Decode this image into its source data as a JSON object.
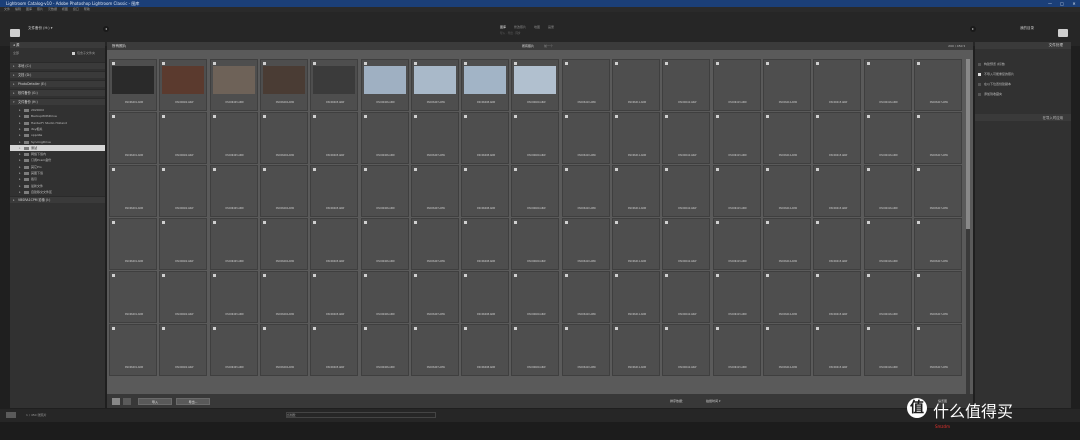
{
  "window": {
    "title": "Lightroom Catalog-v10 - Adobe Photoshop Lightroom Classic - 图库",
    "min": "—",
    "max": "□",
    "close": "✕"
  },
  "menu": [
    "文件",
    "编辑",
    "图库",
    "照片",
    "元数据",
    "视图",
    "窗口",
    "帮助"
  ],
  "top": {
    "source_label": "文件备份 (H:) ▾",
    "modules": [
      "图库",
      "修改照片",
      "地图",
      "画册",
      "幻灯片放映",
      "打印",
      "Web"
    ],
    "active_module": "图库",
    "submodule_line": "导入 · 导出 · 同步",
    "right_label": "我的目录"
  },
  "left": {
    "nav_header": "◂ 源",
    "nav_sub_left": "全部",
    "nav_sub_right": "包含子文件夹",
    "sections": [
      {
        "label": "本地 (C:)"
      },
      {
        "label": "文档 (D:)"
      },
      {
        "label": "PhotoDetailer (E:)"
      },
      {
        "label": "软件备份 (G:)"
      },
      {
        "label": "文件备份 (H:)"
      }
    ],
    "folders": [
      {
        "label": "2020Old"
      },
      {
        "label": "BackupWithDrive"
      },
      {
        "label": "HarderFr Studio Holland"
      },
      {
        "label": "itsy相关"
      },
      {
        "label": "oppoRe"
      },
      {
        "label": "SyncingDrive"
      },
      {
        "label": "测试"
      },
      {
        "label": "网络下载内"
      },
      {
        "label": "订阅Pcam备份"
      },
      {
        "label": "其它Pro"
      },
      {
        "label": "其图下载"
      },
      {
        "label": "截引"
      },
      {
        "label": "最新文件"
      },
      {
        "label": "自建移交文件区"
      }
    ],
    "selected_folder": "测试",
    "last_section": "VBSRA1CPM 影像 (I:)"
  },
  "grid": {
    "header": "所有照片",
    "tabs": [
      "所有照片",
      "前一个"
    ],
    "tab_right": "200 / 450 ▾",
    "filenames": [
      "DSC06401.ARW",
      "DSC06402.ARW",
      "DSC06403.ARW",
      "DSC06404.ARW",
      "DSC06405.ARW",
      "DSC06406.ARW",
      "DSC06407.ARW",
      "DSC06408.ARW",
      "DSC06409.ARW",
      "DSC06410.ARW",
      "DSC06411.ARW",
      "DSC06412.ARW",
      "DSC06413.ARW",
      "DSC06414.ARW",
      "DSC06415.ARW",
      "DSC06416.ARW",
      "DSC06417.ARW"
    ]
  },
  "toolbar": {
    "import": "导入",
    "export": "导出...",
    "filter_label": "排序依据：",
    "filter_value": "拍摄时间 ▾",
    "thumb_label": "缩览图"
  },
  "right": {
    "header": "文件处理",
    "options": [
      {
        "label": "构建预览 (标准)",
        "checked": false
      },
      {
        "label": "不导入可能重复的照片",
        "checked": true
      },
      {
        "label": "在以下位置创建副本",
        "checked": false
      },
      {
        "label": "添加到收藏夹",
        "checked": false
      }
    ],
    "footer": "在导入时应用"
  },
  "filmbar": {
    "left_text": "1 / 450 张照片",
    "center_text": "过滤器："
  },
  "logo": {
    "text": "什么值得买",
    "url_text": "Smzdm"
  },
  "colors": {
    "accent_blue": "#1b3f78",
    "logo_red": "#e8322d"
  }
}
